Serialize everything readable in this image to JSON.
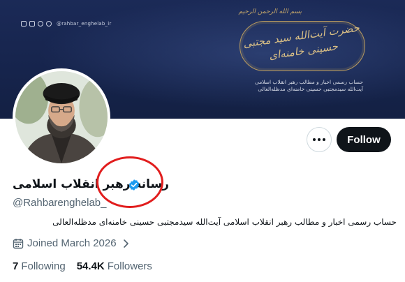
{
  "banner": {
    "social_handle": "@rahbar_enghelab_ir",
    "basmala": "بسم الله الرحمن الرحیم",
    "calligraphy": "حضرت آیت‌الله سید مجتبی حسینی خامنه‌ای",
    "line1": "حساب رسمی اخبار و مطالب رهبر انقلاب اسلامی",
    "line2": "آیت‌الله سیدمجتبی حسینی خامنه‌ای مدظله‌العالی",
    "colors": {
      "background": "#16244c",
      "gold": "#c8a96a"
    }
  },
  "profile": {
    "display_name": "رسانه رهبر انقلاب اسلامی",
    "handle": "@Rahbarenghelab_",
    "verified": true,
    "bio": "حساب رسمی اخبار و مطالب رهبر انقلاب اسلامی آیت‌الله سیدمجتبی حسینی خامنه‌ای مدظله‌العالی",
    "joined": "Joined March 2026"
  },
  "actions": {
    "follow_label": "Follow",
    "more_icon": "more-horizontal-icon"
  },
  "stats": {
    "following_count": "7",
    "following_label": "Following",
    "followers_count": "54.4K",
    "followers_label": "Followers"
  },
  "annotation": {
    "highlight_color": "#e11d1d"
  },
  "colors": {
    "text": "#0f1419",
    "secondary_text": "#536471",
    "verified_blue": "#1d9bf0",
    "button_dark": "#0f1419"
  }
}
